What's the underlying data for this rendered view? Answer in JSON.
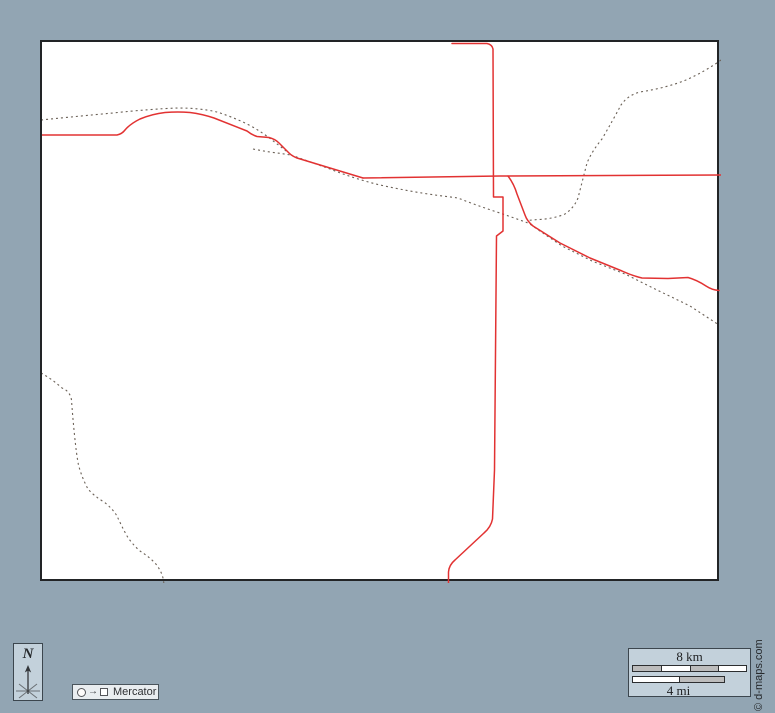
{
  "window": {
    "background_color": "#92a5b3"
  },
  "map": {
    "fill_color": "#ffffff",
    "border_color": "#222426",
    "road_color": "#e23232",
    "stream_color": "#6b6157",
    "features": {
      "roads": [
        "west-road",
        "east-horizontal-road",
        "southeast-road",
        "north-south-road"
      ],
      "streams": [
        "north-stream",
        "short-tributary",
        "main-stream",
        "northeast-tributary",
        "southwest-stream"
      ]
    }
  },
  "compass": {
    "label": "N"
  },
  "projection": {
    "arrow": "→",
    "label": "Mercator"
  },
  "scale": {
    "km_label": "8 km",
    "mi_label": "4 mi"
  },
  "credit": {
    "text": "© d-maps.com"
  }
}
